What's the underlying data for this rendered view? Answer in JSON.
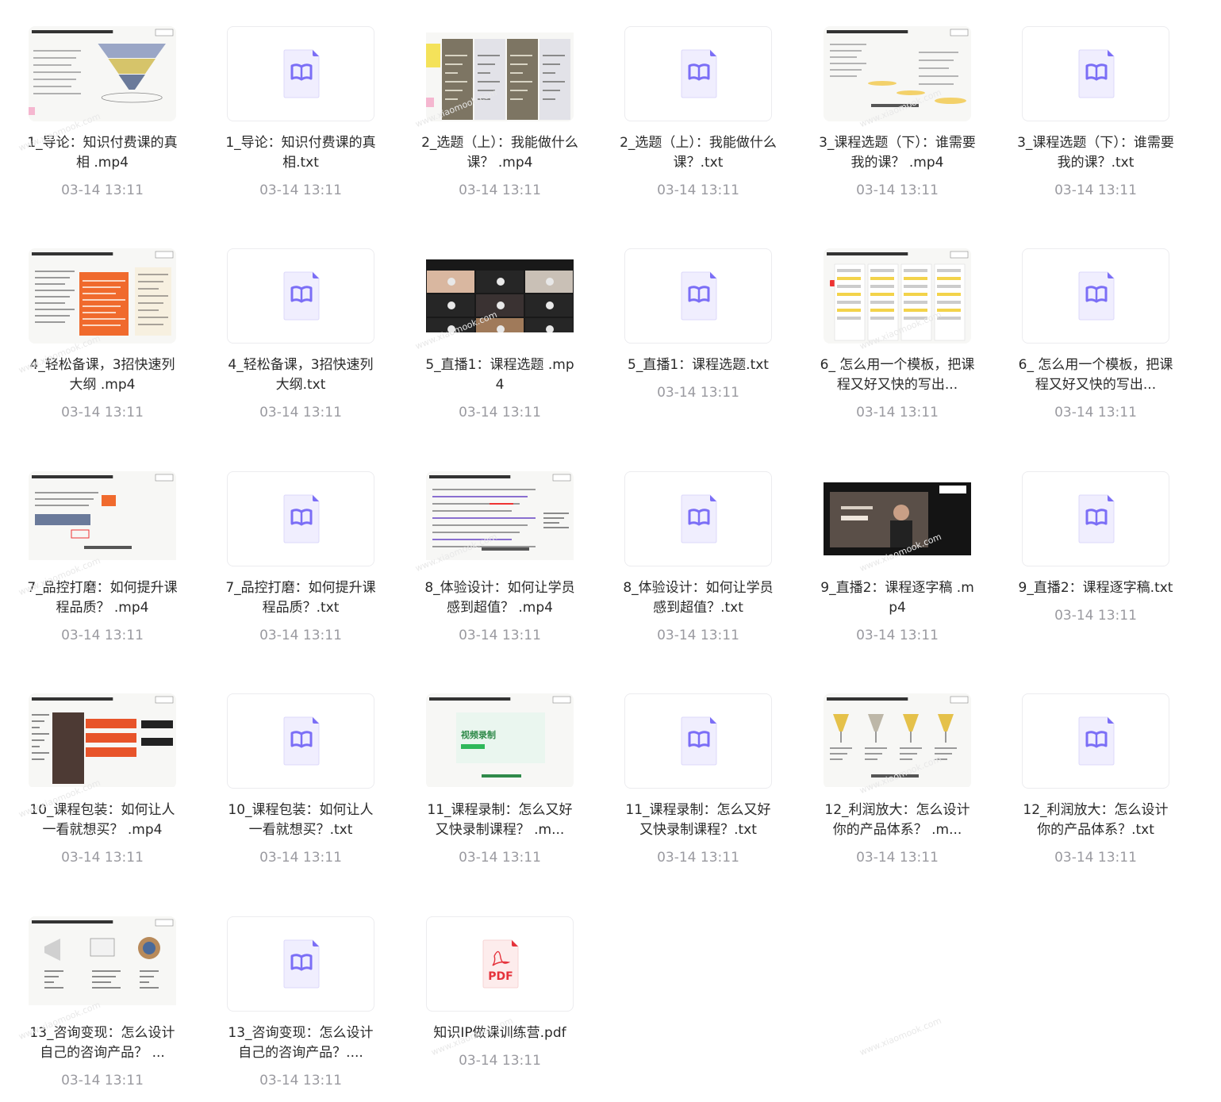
{
  "watermark": "www.xiaomook.com",
  "colors": {
    "name_text": "#2a2a2a",
    "date_text": "#9a9aa0",
    "txt_icon": "#7b6ef6",
    "pdf_icon": "#e5323b"
  },
  "files": [
    {
      "name": "1_导论：知识付费课的真相 .mp4",
      "date": "03-14 13:11",
      "kind": "video",
      "thumb": "funnel"
    },
    {
      "name": "1_导论：知识付费课的真相.txt",
      "date": "03-14 13:11",
      "kind": "txt",
      "icon": "book-icon"
    },
    {
      "name": "2_选题（上）：我能做什么课？ .mp4",
      "date": "03-14 13:11",
      "kind": "video",
      "thumb": "columns"
    },
    {
      "name": "2_选题（上）：我能做什么课？.txt",
      "date": "03-14 13:11",
      "kind": "txt",
      "icon": "book-icon"
    },
    {
      "name": "3_课程选题（下）：谁需要我的课？ .mp4",
      "date": "03-14 13:11",
      "kind": "video",
      "thumb": "timeline"
    },
    {
      "name": "3_课程选题（下）：谁需要我的课？.txt",
      "date": "03-14 13:11",
      "kind": "txt",
      "icon": "book-icon"
    },
    {
      "name": "4_轻松备课，3招快速列大纲 .mp4",
      "date": "03-14 13:11",
      "kind": "video",
      "thumb": "outline"
    },
    {
      "name": "4_轻松备课，3招快速列大纲.txt",
      "date": "03-14 13:11",
      "kind": "txt",
      "icon": "book-icon"
    },
    {
      "name": "5_直播1：课程选题 .mp4",
      "date": "03-14 13:11",
      "kind": "video",
      "thumb": "meeting"
    },
    {
      "name": "5_直播1：课程选题.txt",
      "date": "03-14 13:11",
      "kind": "txt",
      "icon": "book-icon"
    },
    {
      "name": "6_ 怎么用一个模板，把课程又好又快的写出...",
      "date": "03-14 13:11",
      "kind": "video",
      "thumb": "template"
    },
    {
      "name": "6_ 怎么用一个模板，把课程又好又快的写出...",
      "date": "03-14 13:11",
      "kind": "txt",
      "icon": "book-icon"
    },
    {
      "name": "7_品控打磨：如何提升课程品质？ .mp4",
      "date": "03-14 13:11",
      "kind": "video",
      "thumb": "quality"
    },
    {
      "name": "7_品控打磨：如何提升课程品质？.txt",
      "date": "03-14 13:11",
      "kind": "txt",
      "icon": "book-icon"
    },
    {
      "name": "8_体验设计：如何让学员感到超值？ .mp4",
      "date": "03-14 13:11",
      "kind": "video",
      "thumb": "textdoc"
    },
    {
      "name": "8_体验设计：如何让学员感到超值？.txt",
      "date": "03-14 13:11",
      "kind": "txt",
      "icon": "book-icon"
    },
    {
      "name": "9_直播2：课程逐字稿 .mp4",
      "date": "03-14 13:11",
      "kind": "video",
      "thumb": "presenter"
    },
    {
      "name": "9_直播2：课程逐字稿.txt",
      "date": "03-14 13:11",
      "kind": "txt",
      "icon": "book-icon"
    },
    {
      "name": "10_课程包装：如何让人一看就想买？ .mp4",
      "date": "03-14 13:11",
      "kind": "video",
      "thumb": "package"
    },
    {
      "name": "10_课程包装：如何让人一看就想买？.txt",
      "date": "03-14 13:11",
      "kind": "txt",
      "icon": "book-icon"
    },
    {
      "name": "11_课程录制：怎么又好又快录制课程？ .m...",
      "date": "03-14 13:11",
      "kind": "video",
      "thumb": "greenapp",
      "thumb_text": "视频录制"
    },
    {
      "name": "11_课程录制：怎么又好又快录制课程？.txt",
      "date": "03-14 13:11",
      "kind": "txt",
      "icon": "book-icon"
    },
    {
      "name": "12_利润放大：怎么设计你的产品体系？ .m...",
      "date": "03-14 13:11",
      "kind": "video",
      "thumb": "cups"
    },
    {
      "name": "12_利润放大：怎么设计你的产品体系？.txt",
      "date": "03-14 13:11",
      "kind": "txt",
      "icon": "book-icon"
    },
    {
      "name": "13_咨询变现：怎么设计自己的咨询产品？ ...",
      "date": "03-14 13:11",
      "kind": "video",
      "thumb": "consult"
    },
    {
      "name": "13_咨询变现：怎么设计自己的咨询产品？....",
      "date": "03-14 13:11",
      "kind": "txt",
      "icon": "book-icon"
    },
    {
      "name": "知识IP做课训练营.pdf",
      "date": "03-14 13:11",
      "kind": "pdf",
      "icon": "pdf-icon",
      "icon_text": "PDF"
    }
  ]
}
